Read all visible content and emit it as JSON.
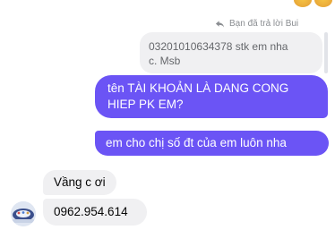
{
  "reply_indicator": {
    "icon": "reply-arrow-icon",
    "text": "Bạn đã trả lời Bui"
  },
  "quoted_message": {
    "line1": "03201010634378 stk em nha",
    "line2": "c. Msb"
  },
  "outgoing_messages": [
    {
      "line1": "tên TÀI KHOẢN LÀ DANG CONG",
      "line2": "HIEP PK EM?"
    },
    {
      "text": "em cho chị số đt của em luôn nha"
    }
  ],
  "incoming_messages": [
    {
      "text": "Vầng c ơi"
    },
    {
      "text": "0962.954.614"
    }
  ],
  "colors": {
    "outgoing_bubble": "#6b54f5",
    "incoming_bubble": "#f0f0f2",
    "reply_indicator_text": "#8a8d91"
  }
}
